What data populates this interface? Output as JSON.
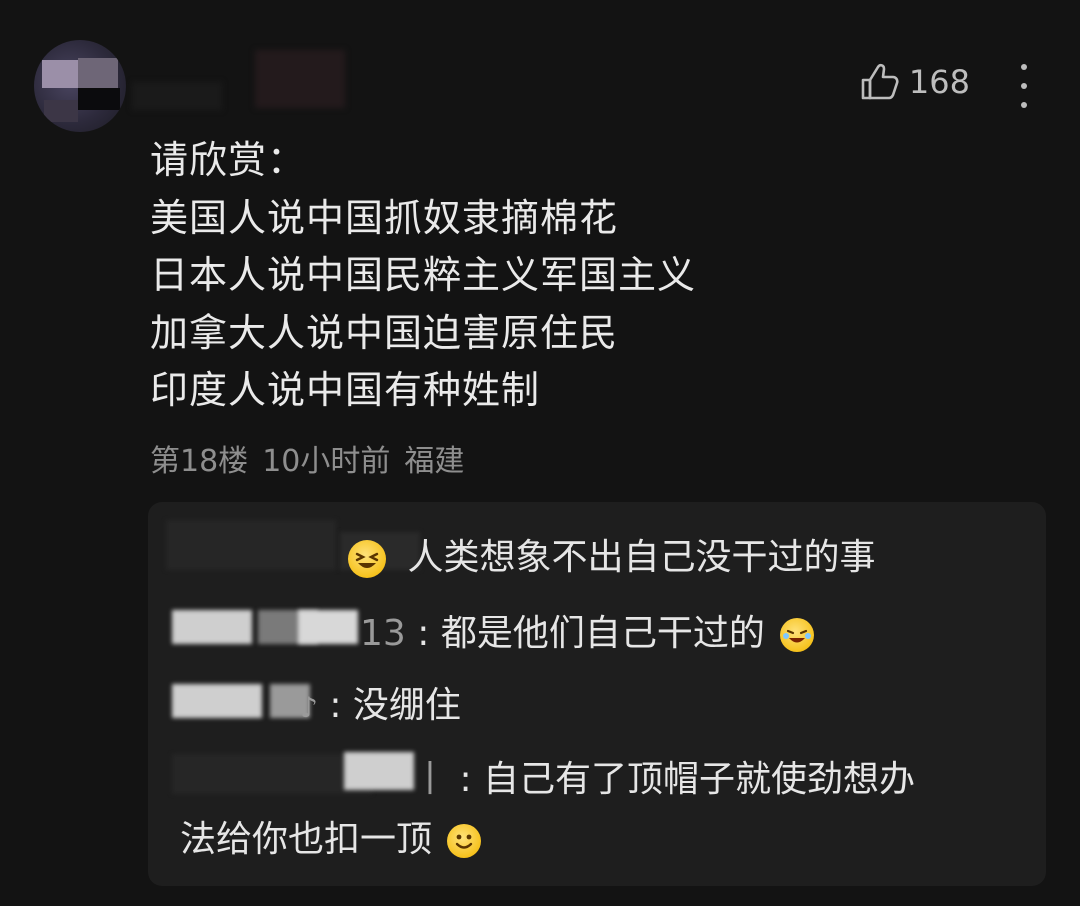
{
  "post": {
    "like_count": "168",
    "lines": [
      "请欣赏：",
      "美国人说中国抓奴隶摘棉花",
      "日本人说中国民粹主义军国主义",
      "加拿大人说中国迫害原住民",
      "印度人说中国有种姓制"
    ],
    "meta": {
      "floor": "第18楼",
      "time": "10小时前",
      "location": "福建"
    }
  },
  "replies": [
    {
      "name_tail": "",
      "text": "人类想象不出自己没干过的事",
      "emoji_before": "laughing-squint",
      "emoji_after": ""
    },
    {
      "name_tail": "13",
      "text": "都是他们自己干过的",
      "emoji_before": "",
      "emoji_after": "laughing-tears"
    },
    {
      "name_tail": "♪",
      "text": "没绷住",
      "emoji_before": "",
      "emoji_after": ""
    },
    {
      "name_tail": "丨",
      "text_line1": "自己有了顶帽子就使劲想办",
      "text_line2": "法给你也扣一顶",
      "emoji_after": "smile"
    }
  ],
  "colors": {
    "background": "#131313",
    "reply_box": "#1e1e1e",
    "meta_text": "#8e8e8e",
    "emoji_yellow": "#f6c21e"
  },
  "icons": [
    "thumbs-up-icon",
    "more-vertical-icon"
  ]
}
